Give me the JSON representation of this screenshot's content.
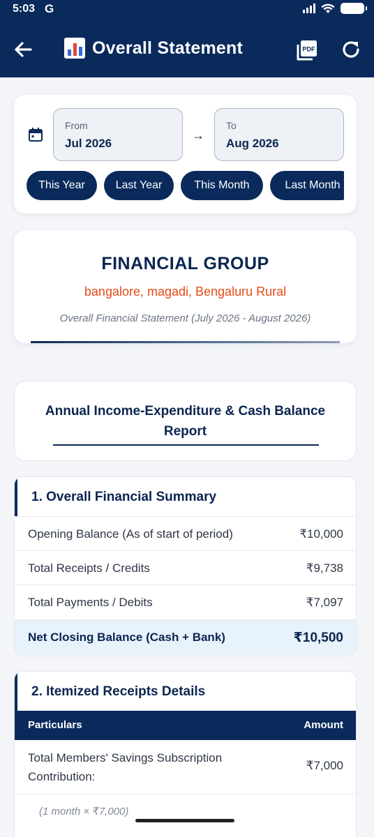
{
  "status_bar": {
    "time": "5:03",
    "carrier_icon": "G"
  },
  "app_bar": {
    "title": "Overall Statement",
    "title_icon": "bar-chart-icon",
    "back_icon": "arrow-left-icon",
    "pdf_label": "PDF",
    "refresh_icon": "refresh-icon",
    "bg_color": "#0a2a5c"
  },
  "date_filter": {
    "from_label": "From",
    "from_value": "Jul 2026",
    "arrow": "→",
    "to_label": "To",
    "to_value": "Aug 2026",
    "presets": [
      "This Year",
      "Last Year",
      "This Month",
      "Last Month"
    ]
  },
  "org": {
    "name": "FINANCIAL GROUP",
    "address": "bangalore, magadi, Bengaluru Rural",
    "subtitle": "Overall Financial Statement (July 2026 - August 2026)"
  },
  "report": {
    "title": "Annual Income-Expenditure & Cash Balance Report"
  },
  "summary": {
    "title": "1. Overall Financial Summary",
    "rows": [
      {
        "label": "Opening Balance (As of start of period)",
        "amount": "₹10,000"
      },
      {
        "label": "Total Receipts / Credits",
        "amount": "₹9,738"
      },
      {
        "label": "Total Payments / Debits",
        "amount": "₹7,097"
      }
    ],
    "total": {
      "label": "Net Closing Balance (Cash + Bank)",
      "amount": "₹10,500"
    }
  },
  "receipts": {
    "title": "2. Itemized Receipts Details",
    "col_particulars": "Particulars",
    "col_amount": "Amount",
    "rows": [
      {
        "label": "Total Members' Savings Subscription Contribution:",
        "amount": "₹7,000",
        "note": "(1 month × ₹7,000)"
      }
    ]
  },
  "colors": {
    "primary": "#0a2a5c",
    "accent_orange": "#e54b14",
    "highlight": "#e8f2fb"
  }
}
